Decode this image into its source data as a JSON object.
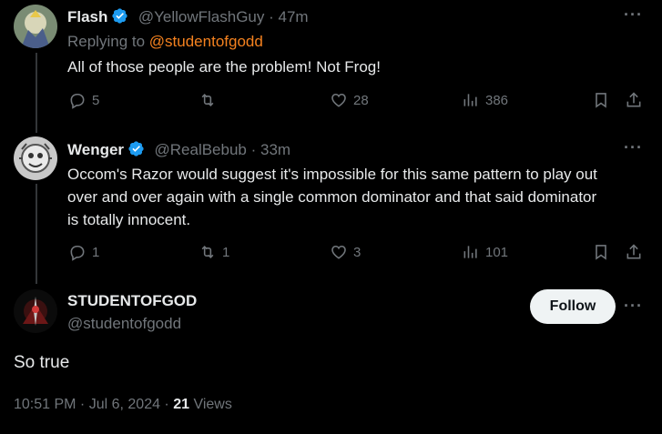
{
  "reply1": {
    "display_name": "Flash",
    "handle": "@YellowFlashGuy",
    "time": "47m",
    "replying_prefix": "Replying to",
    "replying_to": "@studentofgodd",
    "text": "All of those people are the problem! Not Frog!",
    "replies": "5",
    "reposts": "",
    "likes": "28",
    "views": "386"
  },
  "reply2": {
    "display_name": "Wenger",
    "handle": "@RealBebub",
    "time": "33m",
    "text_lines": [
      "Occom's Razor would suggest it's impossible for this same pattern to play out",
      "over and over again with a single common dominator and that said dominator",
      "is totally innocent."
    ],
    "replies": "1",
    "reposts": "1",
    "likes": "3",
    "views": "101"
  },
  "main_post": {
    "display_name": "STUDENTOFGOD",
    "handle": "@studentofgodd",
    "follow_label": "Follow",
    "text": "So true",
    "timestamp": "10:51 PM · Jul 6, 2024 · ",
    "views_count": "21",
    "views_label": " Views"
  },
  "more_menu": "···",
  "separator": " · ",
  "colors": {
    "background": "#000000",
    "text": "#e7e9ea",
    "muted": "#71767b",
    "verified": "#1d9bf0",
    "mention": "#f5821f",
    "follow_bg": "#eff3f4"
  }
}
